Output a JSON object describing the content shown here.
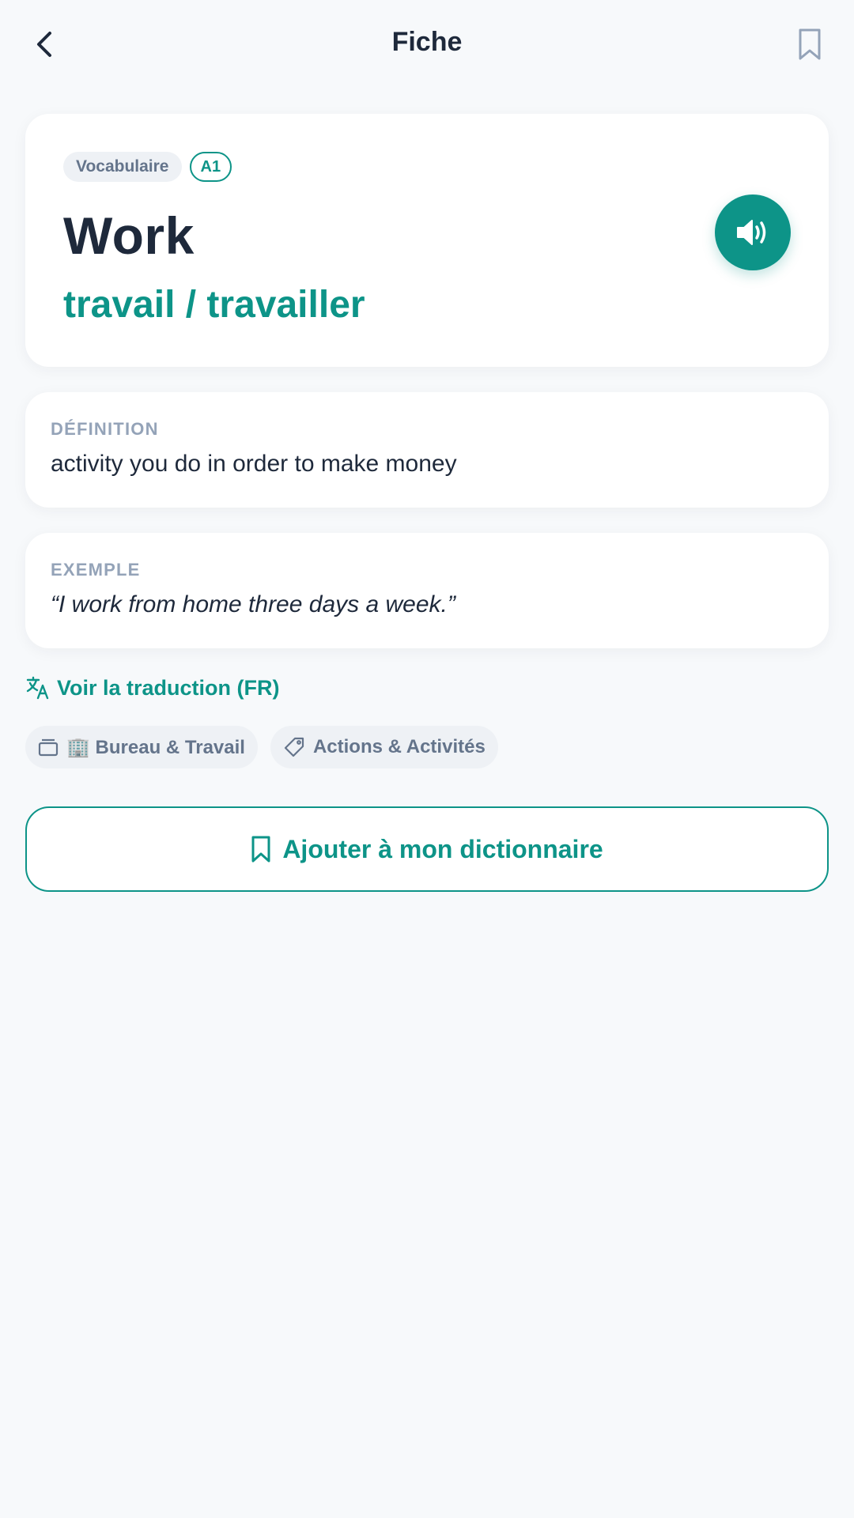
{
  "header": {
    "title": "Fiche",
    "back_icon": "chevron-left-icon",
    "bookmark_icon": "bookmark-outline-icon"
  },
  "word_card": {
    "type_label": "Vocabulaire",
    "level": "A1",
    "word": "Work",
    "translation": "travail / travailler",
    "audio_icon": "speaker-icon"
  },
  "definition": {
    "label": "DÉFINITION",
    "text": "activity you do in order to make money"
  },
  "example": {
    "label": "EXEMPLE",
    "text": "“I work from home three days a week.”"
  },
  "translate_link": {
    "label": "Voir la traduction (FR)",
    "icon": "translate-icon"
  },
  "chips": [
    {
      "label": "🏢 Bureau & Travail",
      "icon": "folder-icon"
    },
    {
      "label": "Actions & Activités",
      "icon": "tag-icon"
    }
  ],
  "add_button": {
    "label": "Ajouter à mon dictionnaire",
    "icon": "bookmark-icon"
  },
  "colors": {
    "accent": "#0d9488",
    "background": "#f7f9fb",
    "text_primary": "#1e293b",
    "text_muted": "#94a3b8"
  }
}
